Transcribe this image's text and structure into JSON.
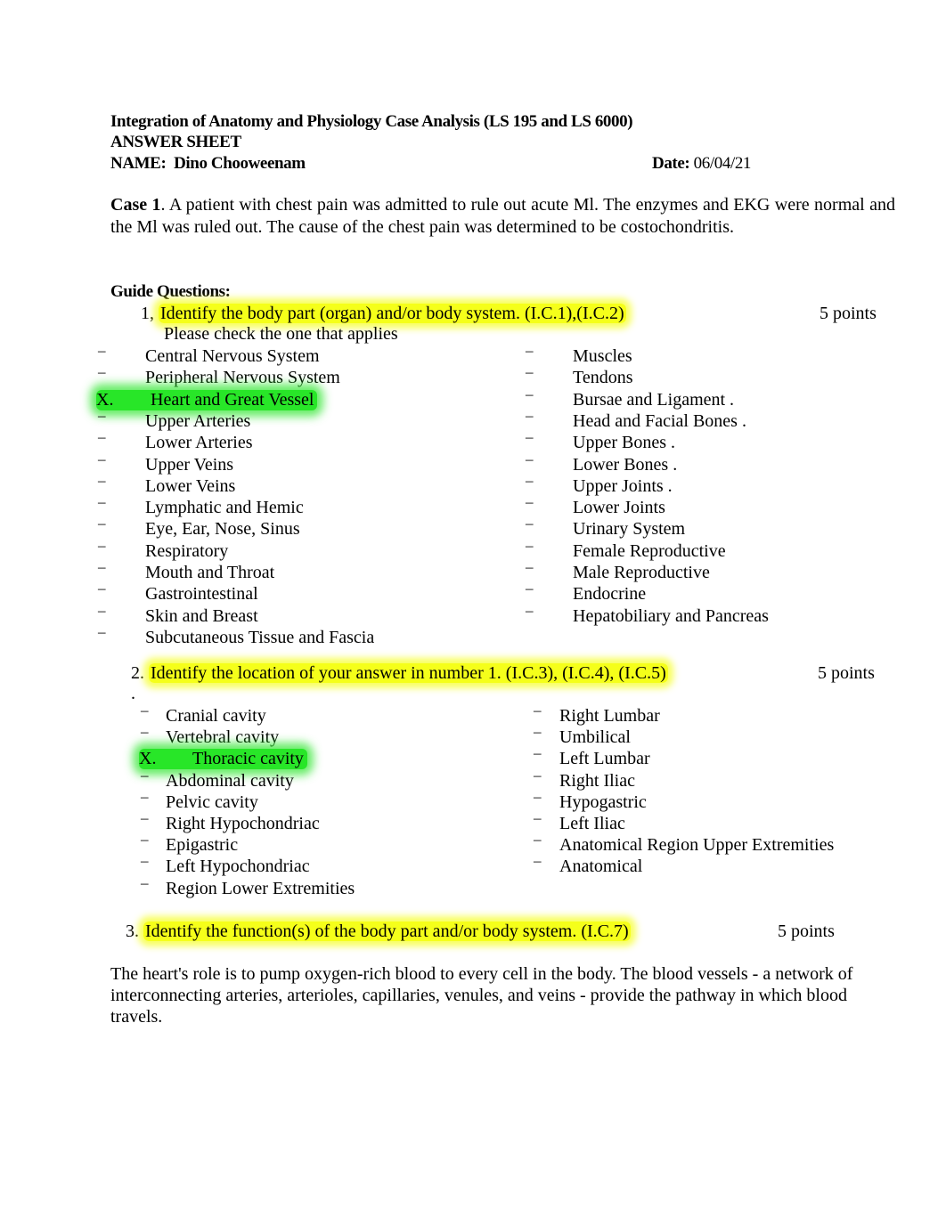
{
  "header": {
    "title": "Integration of Anatomy and Physiology Case Analysis (LS 195 and LS 6000)",
    "subtitle": "ANSWER SHEET",
    "name_label": "NAME:",
    "name_value": "Dino Chooweenam",
    "date_label": "Date:",
    "date_value": "06/04/21"
  },
  "case": {
    "label": "Case 1",
    "text": ". A patient with chest pain was admitted to rule out acute Ml. The enzymes and EKG were normal and the Ml was ruled out. The cause of the chest pain was determined to be costochondritis."
  },
  "guide_label": "Guide Questions:",
  "colors": {
    "question_highlight": "#f5ff1a",
    "answer_highlight": "#28e628"
  },
  "q1": {
    "prefix": "1,",
    "text": "Identify the body part (organ) and/or body system. (I.C.1),(I.C.2)",
    "points": "5 points",
    "instruction": "Please check the one that applies",
    "dash": "–",
    "check_mark": "X.",
    "left_options": [
      {
        "label": "Central Nervous System",
        "checked": false
      },
      {
        "label": "Peripheral Nervous System",
        "checked": false
      },
      {
        "label": "Heart and Great Vessel",
        "checked": true
      },
      {
        "label": "Upper Arteries",
        "checked": false
      },
      {
        "label": "Lower Arteries",
        "checked": false
      },
      {
        "label": "Upper Veins",
        "checked": false
      },
      {
        "label": "Lower Veins",
        "checked": false
      },
      {
        "label": "Lymphatic and Hemic",
        "checked": false
      },
      {
        "label": "Eye, Ear, Nose, Sinus",
        "checked": false
      },
      {
        "label": "Respiratory",
        "checked": false
      },
      {
        "label": "Mouth and Throat",
        "checked": false
      },
      {
        "label": "Gastrointestinal",
        "checked": false
      },
      {
        "label": "Skin and Breast",
        "checked": false
      },
      {
        "label": "Subcutaneous Tissue and Fascia",
        "checked": false
      }
    ],
    "right_options": [
      {
        "label": "Muscles",
        "checked": false
      },
      {
        "label": "Tendons",
        "checked": false
      },
      {
        "label": "Bursae and Ligament .",
        "checked": false
      },
      {
        "label": "Head and Facial Bones .",
        "checked": false
      },
      {
        "label": "Upper Bones .",
        "checked": false
      },
      {
        "label": "Lower Bones .",
        "checked": false
      },
      {
        "label": "Upper Joints .",
        "checked": false
      },
      {
        "label": "Lower Joints",
        "checked": false
      },
      {
        "label": "Urinary System",
        "checked": false
      },
      {
        "label": "Female Reproductive",
        "checked": false
      },
      {
        "label": "Male Reproductive",
        "checked": false
      },
      {
        "label": "Endocrine",
        "checked": false
      },
      {
        "label": "Hepatobiliary and Pancreas",
        "checked": false
      }
    ]
  },
  "q2": {
    "prefix": "2.",
    "text": "Identify the location of your answer in number 1. (I.C.3), (I.C.4), (I.C.5)",
    "points": "5 points",
    "stray_mark": ".",
    "dash": "–",
    "check_mark": "X.",
    "left_options": [
      {
        "label": "Cranial cavity",
        "checked": false
      },
      {
        "label": "Vertebral cavity",
        "checked": false
      },
      {
        "label": "Thoracic cavity",
        "checked": true
      },
      {
        "label": "Abdominal cavity",
        "checked": false
      },
      {
        "label": "Pelvic cavity",
        "checked": false
      },
      {
        "label": "Right Hypochondriac",
        "checked": false
      },
      {
        "label": "Epigastric",
        "checked": false
      },
      {
        "label": "Left Hypochondriac",
        "checked": false
      },
      {
        "label": "Region Lower Extremities",
        "checked": false
      }
    ],
    "right_options": [
      {
        "label": "Right Lumbar",
        "checked": false
      },
      {
        "label": "Umbilical",
        "checked": false
      },
      {
        "label": "Left Lumbar",
        "checked": false
      },
      {
        "label": "Right Iliac",
        "checked": false
      },
      {
        "label": "Hypogastric",
        "checked": false
      },
      {
        "label": "Left Iliac",
        "checked": false
      },
      {
        "label": "Anatomical Region Upper Extremities",
        "checked": false
      },
      {
        "label": "Anatomical",
        "checked": false
      }
    ]
  },
  "q3": {
    "prefix": "3.",
    "text": "Identify the function(s) of the body part and/or body system. (I.C.7)",
    "points": "5 points",
    "answer": "The heart's role is to pump oxygen-rich blood to every cell in the body. The blood vessels - a network of interconnecting arteries, arterioles, capillaries, venules, and veins - provide the pathway in which blood travels."
  }
}
